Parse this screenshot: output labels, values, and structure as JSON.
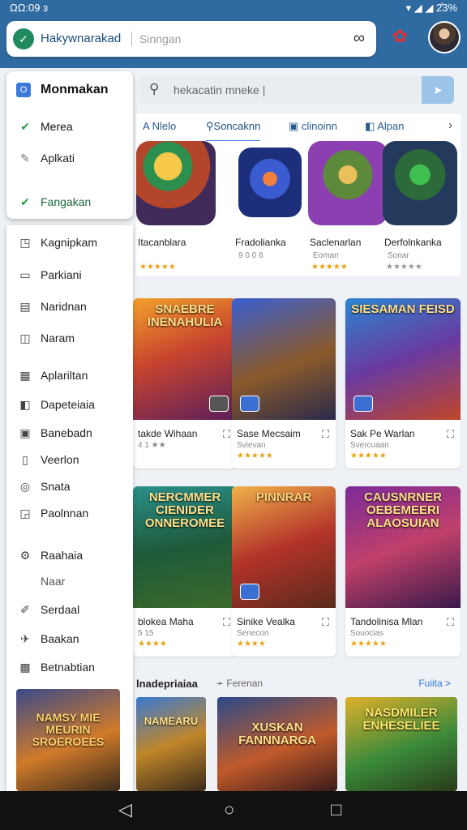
{
  "status": {
    "time": "ΩΩ:09 ɜ",
    "right": "▾ ◢ ◢ 2̊3%"
  },
  "topbar": {
    "app_title": "Hakywnarakad",
    "search_placeholder": "Sinngan",
    "logo_glyph": "✓"
  },
  "search2": {
    "text": "hekacatin mneke |",
    "go": "➤"
  },
  "tabs": [
    "Nlelo",
    "Soncaknn",
    "clinoinn",
    "Alpan"
  ],
  "row1": [
    {
      "title": "Itacanblara",
      "sub": "",
      "stars": "★★★★★"
    },
    {
      "title": "Fradolianka",
      "sub": "9 0 0 6",
      "stars": ""
    },
    {
      "title": "Saclenarlan",
      "sub": "Eoman",
      "stars": "★★★★★"
    },
    {
      "title": "Derfolnkanka",
      "sub": "Sonar",
      "stars": "★★★★★"
    }
  ],
  "grid": [
    {
      "art": "SNAEBRE INENAHULIA",
      "title": "takde Wihaan",
      "sub": "4 1 ★★",
      "stars": ""
    },
    {
      "art": "",
      "title": "Sase Mecsaim",
      "sub": "Svievan",
      "stars": "★★★★★"
    },
    {
      "art": "SIESAMAN FEISD",
      "title": "Sak Pe Warlan",
      "sub": "Svercuaan",
      "stars": "★★★★★"
    },
    {
      "art": "NERCMMER CIENIDER ONNEROMEE",
      "title": "blokea Maha",
      "sub": "5 15",
      "stars": "★★★★"
    },
    {
      "art": "PINNRAR",
      "title": "Sinike Vealka",
      "sub": "Senecon",
      "stars": "★★★★"
    },
    {
      "art": "CAUSNRNER OEBEMEERI ALAOSUIAN",
      "title": "Tandolinisa Mlan",
      "sub": "Souocias",
      "stars": "★★★★★"
    }
  ],
  "section": {
    "title": "lnadepriaiaa",
    "sub": "Ferenan",
    "more": "Fuiita >"
  },
  "bottom_arts": [
    "NAMEARU",
    "XUSKAN FANNNARGA",
    "NASDMILER ENHESELIEE"
  ],
  "drawer": {
    "header": "Monmakan",
    "header_icon": "O",
    "items": [
      {
        "label": "Merea",
        "icon": "✔"
      },
      {
        "label": "Aplkati",
        "icon": "✎"
      },
      {
        "label": "Fangakan",
        "icon": "✔"
      }
    ]
  },
  "menu": {
    "items": [
      {
        "label": "Kagnipkam",
        "icon": "◳"
      },
      {
        "label": "Parkiani",
        "icon": "▭"
      },
      {
        "label": "Naridnan",
        "icon": "▤"
      },
      {
        "label": "Naram",
        "icon": "◫"
      },
      {
        "label": "Aplariltan",
        "icon": "▦"
      },
      {
        "label": "Dapeteiaia",
        "icon": "◧"
      },
      {
        "label": "Banebadn",
        "icon": "▣"
      },
      {
        "label": "Veerlon",
        "icon": "▯"
      },
      {
        "label": "Snata",
        "icon": "◎"
      },
      {
        "label": "Paolnnan",
        "icon": "◲"
      },
      {
        "label": "Raahaia",
        "icon": "⚙"
      },
      {
        "label": "Naar",
        "icon": ""
      },
      {
        "label": "Serdaal",
        "icon": "✐"
      },
      {
        "label": "Baakan",
        "icon": "✈"
      },
      {
        "label": "Betnabtian",
        "icon": "▩"
      }
    ],
    "promo_art": "NAMSY MIE MEURIN SROEROEES"
  },
  "nav": {
    "back": "◁",
    "home": "○",
    "recent": "□"
  }
}
